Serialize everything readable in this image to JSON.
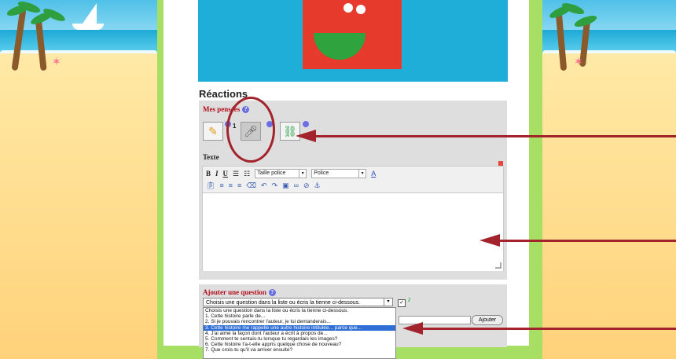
{
  "section_title": "Réactions",
  "my_thoughts": {
    "label": "Mes pensées",
    "help_glyph": "?",
    "write_count": "1",
    "selected_tool": "microphone"
  },
  "editor": {
    "label": "Texte",
    "bold": "B",
    "italic": "I",
    "underline": "U",
    "font_size_placeholder": "Taille police",
    "font_placeholder": "Police",
    "text_color_glyph": "A",
    "content": ""
  },
  "add_question": {
    "label": "Ajouter une question",
    "selected": "Choisis une question dans la liste ou écris la tienne ci-dessous.",
    "options": [
      "Choisis une question dans la liste ou écris la tienne ci-dessous.",
      "1. Cette histoire parle de...",
      "2. Si je pouvais rencontrer l'auteur, je lui demanderais...",
      "3. Cette histoire me rappelle une autre histoire intitulée... parce que...",
      "4. J'ai aimé la façon dont l'auteur a écrit à propos de...",
      "5. Comment te sentais-tu lorsque tu regardais les images?",
      "6. Cette histoire t'a-t-elle appris quelque chose de nouveau?",
      "7. Que crois-tu qu'il va arriver ensuite?"
    ],
    "highlighted_index": 3,
    "add_button": "Ajouter"
  },
  "colors": {
    "accent_red": "#a3232d",
    "page_green": "#a6df63",
    "story_blue": "#1eaed8",
    "highlight_blue": "#2f6ed5"
  }
}
